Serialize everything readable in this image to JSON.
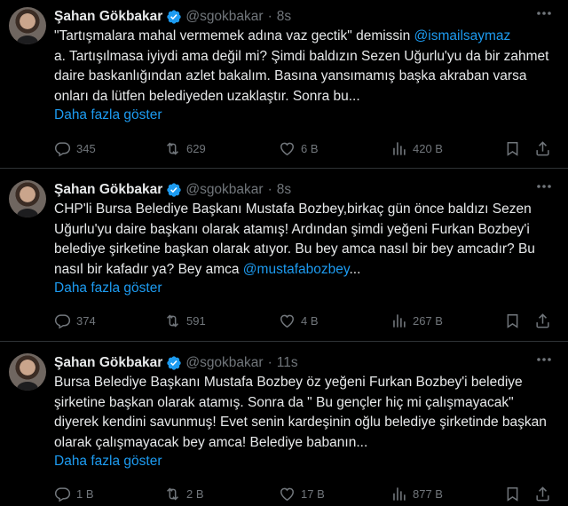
{
  "tweets": [
    {
      "name": "Şahan Gökbakar",
      "handle": "@sgokbakar",
      "dot": "·",
      "time": "8s",
      "text_1": "\"Tartışmalara mahal vermemek adına vaz gectik\" demissin ",
      "mention": "@ismailsaymaz",
      "text_2": "\na. Tartışılmasa iyiydi ama değil mi? Şimdi baldızın Sezen Uğurlu'yu da bir zahmet daire baskanlığından azlet bakalım. Basına yansımamış başka akraban varsa onları da lütfen belediyeden uzaklaştır. Sonra bu...",
      "show_more": "Daha fazla göster",
      "replies": "345",
      "retweets": "629",
      "likes": "6 B",
      "views": "420 B"
    },
    {
      "name": "Şahan Gökbakar",
      "handle": "@sgokbakar",
      "dot": "·",
      "time": "8s",
      "text_1": "CHP'li Bursa Belediye Başkanı Mustafa Bozbey,birkaç gün önce baldızı Sezen Uğurlu'yu daire başkanı olarak atamış! Ardından şimdi yeğeni Furkan Bozbey'i belediye şirketine başkan olarak atıyor. Bu bey amca nasıl bir bey amcadır? Bu nasıl bir kafadır ya? Bey amca ",
      "mention": "@mustafabozbey",
      "text_2": "...",
      "show_more": "Daha fazla göster",
      "replies": "374",
      "retweets": "591",
      "likes": "4 B",
      "views": "267 B"
    },
    {
      "name": "Şahan Gökbakar",
      "handle": "@sgokbakar",
      "dot": "·",
      "time": "11s",
      "text_1": "Bursa Belediye Başkanı Mustafa Bozbey öz yeğeni Furkan Bozbey'i belediye şirketine başkan olarak atamış. Sonra da \" Bu gençler hiç mi çalışmayacak\" diyerek kendini savunmuş! Evet senin kardeşinin oğlu belediye şirketinde başkan olarak çalışmayacak bey amca! Belediye babanın...",
      "mention": "",
      "text_2": "",
      "show_more": "Daha fazla göster",
      "replies": "1 B",
      "retweets": "2 B",
      "likes": "17 B",
      "views": "877 B"
    }
  ],
  "icons": {
    "verified": "verified-badge-icon",
    "more": "more-horizontal-icon",
    "reply": "reply-icon",
    "retweet": "retweet-icon",
    "like": "heart-icon",
    "views": "views-chart-icon",
    "bookmark": "bookmark-icon",
    "share": "share-icon"
  },
  "colors": {
    "background": "#000000",
    "text": "#e7e9ea",
    "muted": "#71767b",
    "accent": "#1d9bf0",
    "divider": "#2f3336"
  }
}
